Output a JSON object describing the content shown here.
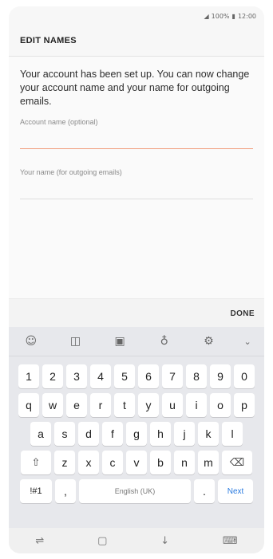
{
  "status_bar": {
    "signal": "◢",
    "battery_percent": "100%",
    "battery_icon": "▮",
    "time": "12:00"
  },
  "header": {
    "title": "EDIT NAMES"
  },
  "content": {
    "description": "Your account has been set up. You can now change your account name and your name for outgoing emails.",
    "fields": [
      {
        "label": "Account name (optional)",
        "value": ""
      },
      {
        "label": "Your name (for outgoing emails)",
        "value": ""
      }
    ]
  },
  "actions": {
    "done_label": "DONE"
  },
  "keyboard": {
    "toolbar_icons": [
      "emoji-icon",
      "sticker-icon",
      "gif-icon",
      "mic-icon",
      "settings-icon",
      "collapse-icon"
    ],
    "row_numbers": [
      "1",
      "2",
      "3",
      "4",
      "5",
      "6",
      "7",
      "8",
      "9",
      "0"
    ],
    "row1": [
      "q",
      "w",
      "e",
      "r",
      "t",
      "y",
      "u",
      "i",
      "o",
      "p"
    ],
    "row2": [
      "a",
      "s",
      "d",
      "f",
      "g",
      "h",
      "j",
      "k",
      "l"
    ],
    "row3": [
      "z",
      "x",
      "c",
      "v",
      "b",
      "n",
      "m"
    ],
    "shift_glyph": "⇧",
    "backspace_glyph": "⌫",
    "symbols_label": "!#1",
    "comma_label": ",",
    "space_label": "English (UK)",
    "period_label": ".",
    "next_label": "Next"
  },
  "nav_bar": {
    "recent_glyph": "⇌",
    "home_glyph": "▢",
    "back_glyph": "↓",
    "keyboard_glyph": "⌨"
  }
}
